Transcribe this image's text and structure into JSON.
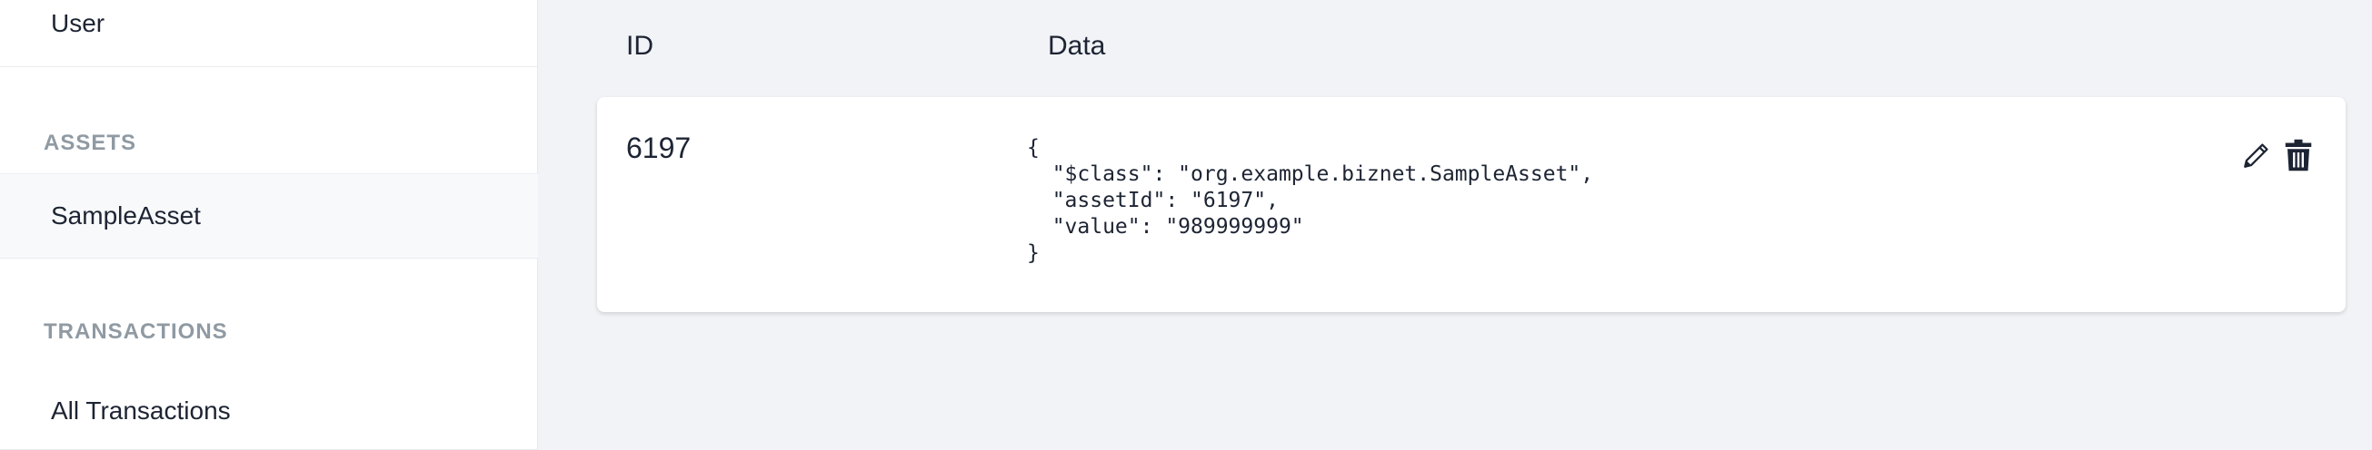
{
  "sidebar": {
    "user_label": "User",
    "assets_header": "ASSETS",
    "sample_asset_label": "SampleAsset",
    "transactions_header": "TRANSACTIONS",
    "all_transactions_label": "All Transactions"
  },
  "table": {
    "headers": {
      "id": "ID",
      "data": "Data"
    },
    "rows": [
      {
        "id": "6197",
        "json": "{\n  \"$class\": \"org.example.biznet.SampleAsset\",\n  \"assetId\": \"6197\",\n  \"value\": \"989999999\"\n}"
      }
    ]
  },
  "icons": {
    "edit": "pencil-icon",
    "delete": "trash-icon"
  },
  "colors": {
    "page_bg": "#f2f3f7",
    "card_bg": "#ffffff",
    "text": "#1d2433",
    "muted": "#8f9aa3"
  }
}
